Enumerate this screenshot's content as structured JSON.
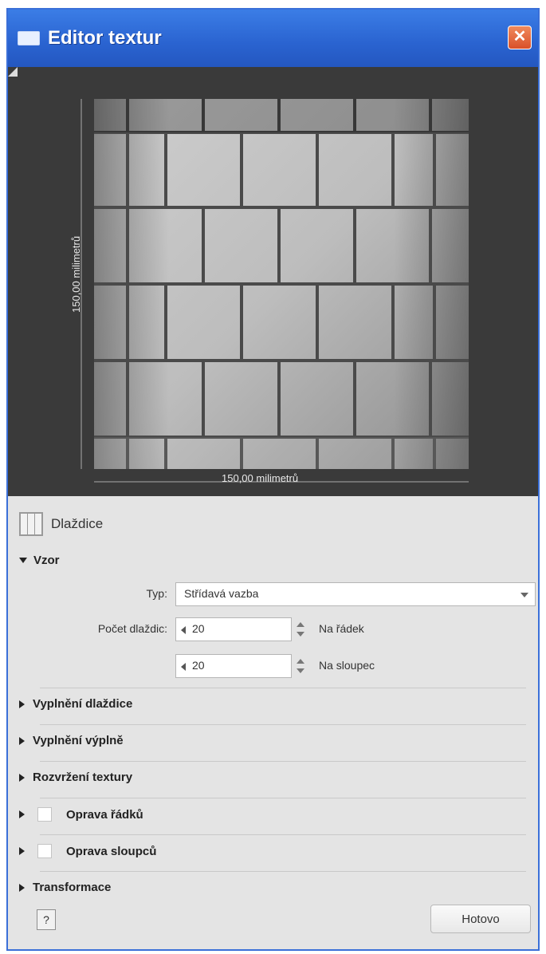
{
  "window": {
    "title": "Editor textur",
    "close_glyph": "✕"
  },
  "preview": {
    "width_label": "150,00 milimetrů",
    "height_label": "150,00 milimetrů"
  },
  "panel": {
    "title": "Dlaždice",
    "sections": {
      "vzor": "Vzor",
      "vyplneni_dlazdice": "Vyplnění dlaždice",
      "vyplneni_vyplni": "Vyplnění výplně",
      "rozvrzeni_textury": "Rozvržení textury",
      "oprava_radku": "Oprava řádků",
      "oprava_sloupcu": "Oprava sloupců",
      "transformace": "Transformace"
    },
    "type_label": "Typ:",
    "type_value": "Střídavá vazba",
    "tile_count_label": "Počet dlaždic:",
    "rows_value": "20",
    "rows_suffix": "Na řádek",
    "cols_value": "20",
    "cols_suffix": "Na sloupec",
    "help_glyph": "?",
    "close_button": "Hotovo"
  },
  "colors": {
    "titlebar": "#2a63d0",
    "preview_bg": "#3a3a3a",
    "panel_bg": "#e4e4e4"
  }
}
